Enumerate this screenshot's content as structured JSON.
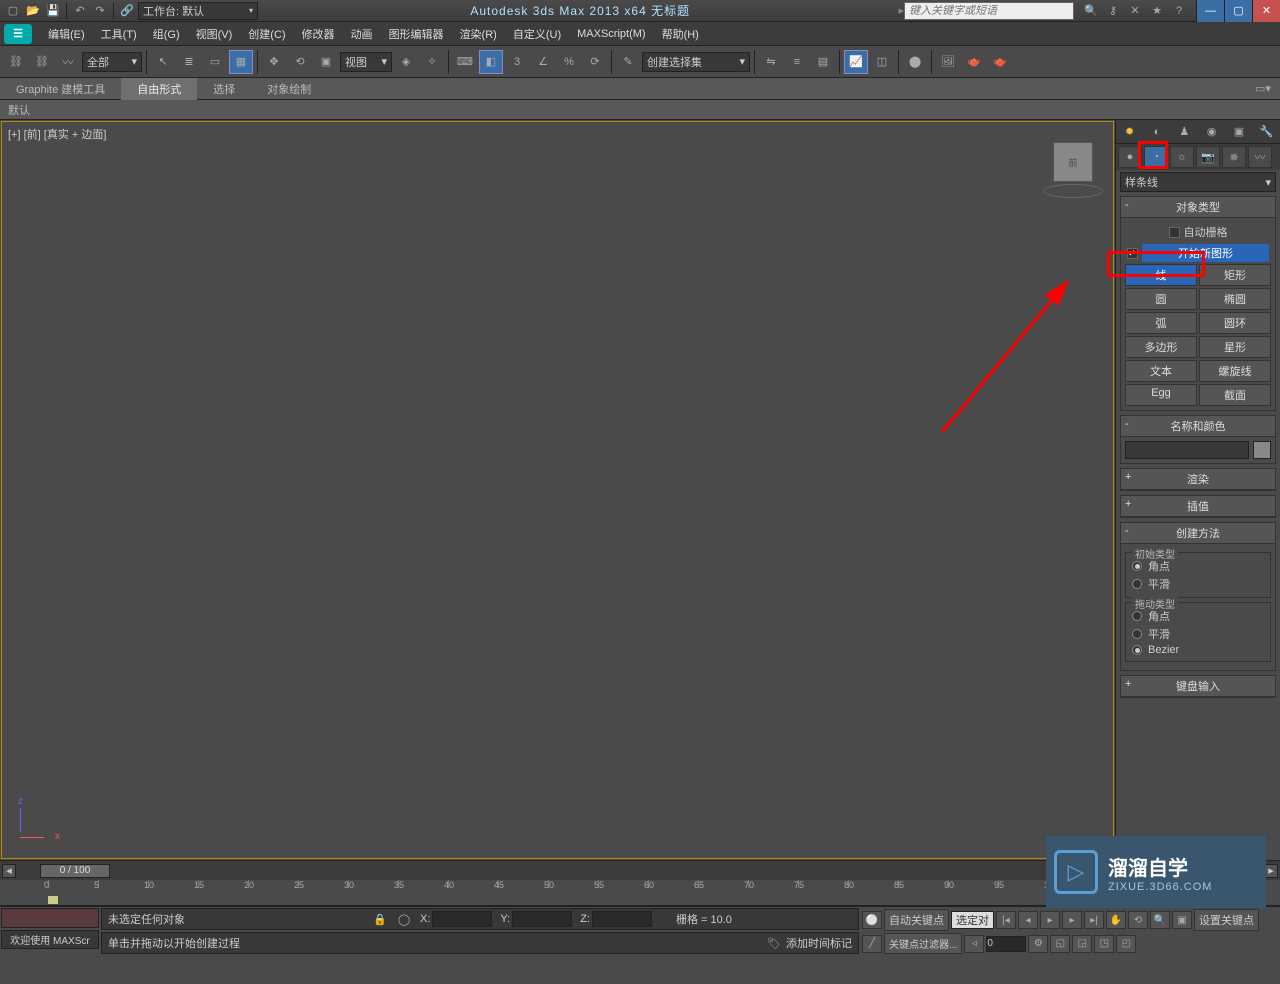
{
  "title": "Autodesk 3ds Max  2013 x64     无标题",
  "workspace_label": "工作台: 默认",
  "search_placeholder": "键入关键字或短语",
  "menus": [
    "编辑(E)",
    "工具(T)",
    "组(G)",
    "视图(V)",
    "创建(C)",
    "修改器",
    "动画",
    "图形编辑器",
    "渲染(R)",
    "自定义(U)",
    "MAXScript(M)",
    "帮助(H)"
  ],
  "toolbar": {
    "filter_all": "全部",
    "view_dd": "视图",
    "named_sel": "创建选择集"
  },
  "ribbon": {
    "tabs": [
      "Graphite 建模工具",
      "自由形式",
      "选择",
      "对象绘制"
    ],
    "active": 1,
    "defaults": "默认"
  },
  "viewport": {
    "label": "[+] [前] [真实 + 边面]",
    "cube": "前"
  },
  "panel": {
    "shape_dd": "样条线",
    "obj_type_hd": "对象类型",
    "auto_grid": "自动栅格",
    "start_new": "开始新图形",
    "buttons": [
      [
        "线",
        "矩形"
      ],
      [
        "圆",
        "椭圆"
      ],
      [
        "弧",
        "圆环"
      ],
      [
        "多边形",
        "星形"
      ],
      [
        "文本",
        "螺旋线"
      ],
      [
        "Egg",
        "截面"
      ]
    ],
    "name_color_hd": "名称和颜色",
    "render_hd": "渲染",
    "interp_hd": "插值",
    "creation_hd": "创建方法",
    "initial_type": "初始类型",
    "drag_type": "拖动类型",
    "r_corner": "角点",
    "r_smooth": "平滑",
    "r_bezier": "Bezier",
    "keyboard_hd": "键盘输入"
  },
  "timeline": {
    "slider": "0 / 100",
    "ticks": [
      0,
      5,
      10,
      15,
      20,
      25,
      30,
      35,
      40,
      45,
      50,
      55,
      60,
      65,
      70,
      75,
      80,
      85,
      90,
      95,
      100
    ]
  },
  "status": {
    "welcome": "欢迎使用  MAXScr",
    "no_sel": "未选定任何对象",
    "hint": "单击并拖动以开始创建过程",
    "grid": "栅格 = 10.0",
    "add_tag": "添加时间标记",
    "auto_key": "自动关键点",
    "set_key": "设置关键点",
    "sel_filter": "选定对",
    "key_filter": "关键点过滤器...",
    "frame": "0",
    "x": "X:",
    "y": "Y:",
    "z": "Z:"
  },
  "watermark": {
    "l1": "溜溜自学",
    "l2": "ZIXUE.3D66.COM"
  }
}
